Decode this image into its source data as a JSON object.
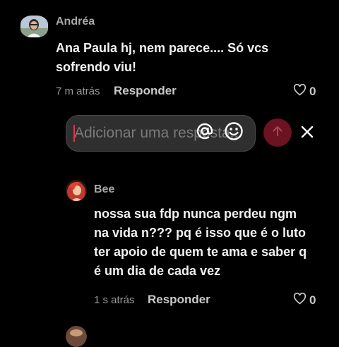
{
  "comments": [
    {
      "author": "Andréa",
      "text_lines": [
        "Ana Paula hj, nem parece.... Só vcs",
        "sofrendo viu!"
      ],
      "time": "7 m atrás",
      "reply_label": "Responder",
      "likes": "0"
    },
    {
      "author": "Bee",
      "text_lines": [
        "nossa sua fdp nunca perdeu ngm",
        "na vida n??? pq é isso que é o luto",
        "ter apoio de quem te ama e saber q",
        "é um dia de cada vez"
      ],
      "time": "1 s atrás",
      "reply_label": "Responder",
      "likes": "0"
    }
  ],
  "reply_input": {
    "placeholder": "Adicionar uma resposta...",
    "value": ""
  },
  "icons": {
    "mention": "at-sign-icon",
    "emoji": "smiley-icon",
    "send": "arrow-up-icon",
    "close": "close-icon",
    "like": "heart-outline-icon"
  },
  "colors": {
    "background": "#000000",
    "send_button": "#6b1320",
    "send_arrow": "#a44a55",
    "caret": "#e0334e"
  }
}
